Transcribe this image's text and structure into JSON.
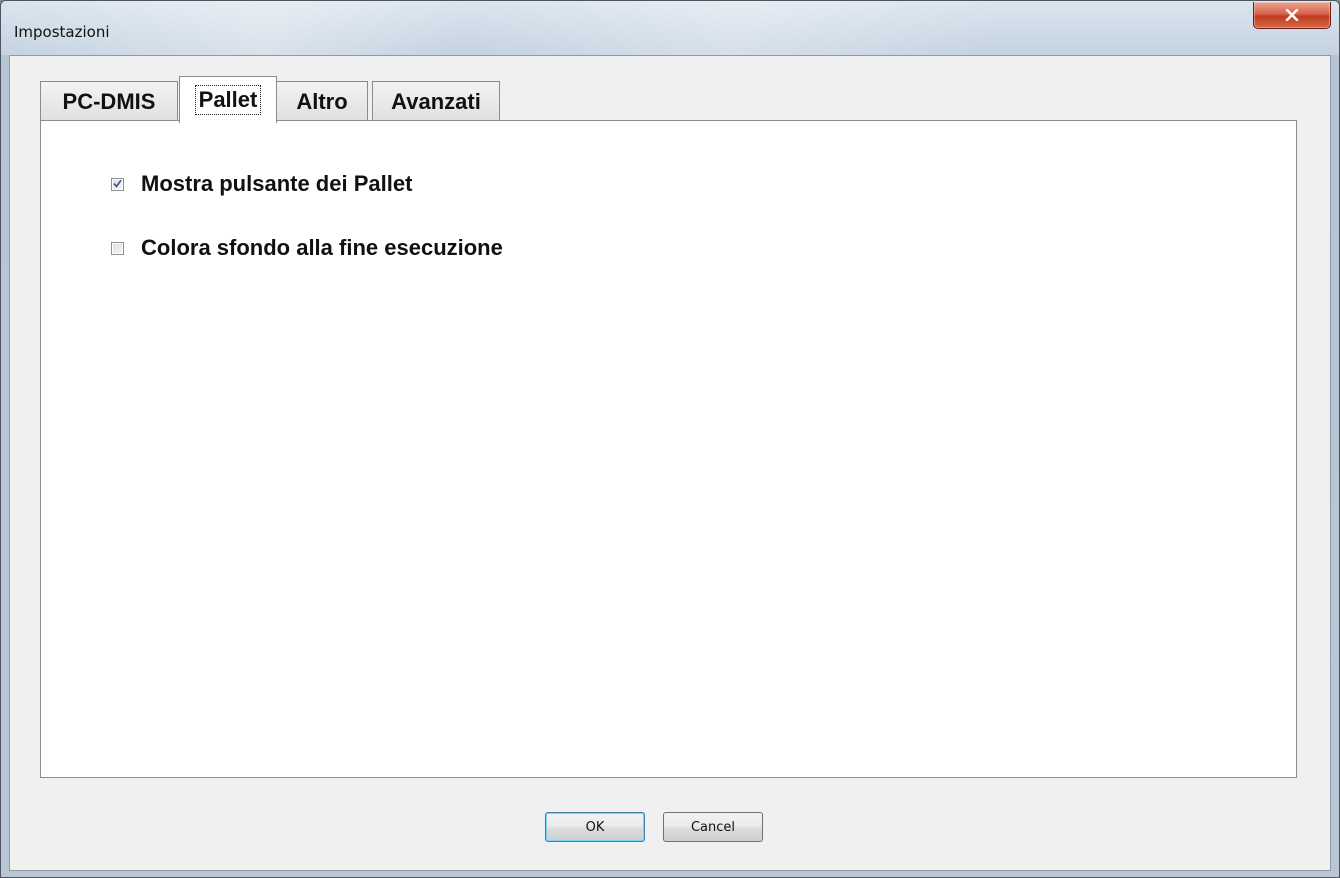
{
  "window": {
    "title": "Impostazioni"
  },
  "tabs": [
    {
      "label": "PC-DMIS",
      "active": false
    },
    {
      "label": "Pallet",
      "active": true
    },
    {
      "label": "Altro",
      "active": false
    },
    {
      "label": "Avanzati",
      "active": false
    }
  ],
  "pallet_tab": {
    "options": [
      {
        "label": "Mostra pulsante dei Pallet",
        "checked": true
      },
      {
        "label": "Colora sfondo alla fine esecuzione",
        "checked": false
      }
    ]
  },
  "buttons": {
    "ok_label": "OK",
    "cancel_label": "Cancel"
  },
  "icons": {
    "close": "close-icon",
    "check": "check-icon"
  },
  "colors": {
    "close_button": "#c13a20",
    "default_button_border": "#3c7fb1"
  }
}
